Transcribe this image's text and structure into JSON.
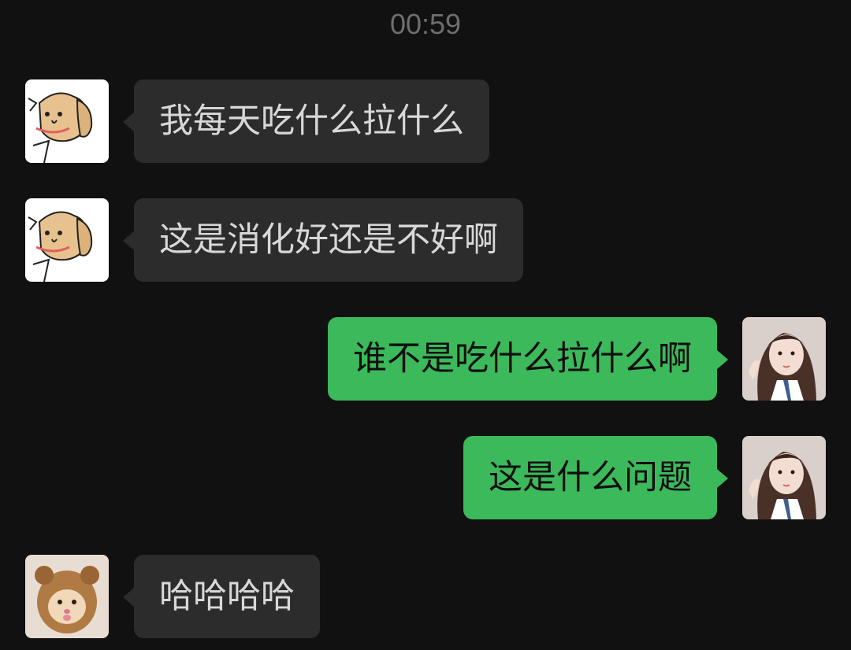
{
  "chat": {
    "timestamp": "00:59",
    "messages": [
      {
        "direction": "incoming",
        "sender_avatar": "dog-sticker-avatar",
        "text": "我每天吃什么拉什么"
      },
      {
        "direction": "incoming",
        "sender_avatar": "dog-sticker-avatar",
        "text": "这是消化好还是不好啊"
      },
      {
        "direction": "outgoing",
        "sender_avatar": "girl-photo-avatar",
        "text": "谁不是吃什么拉什么啊"
      },
      {
        "direction": "outgoing",
        "sender_avatar": "girl-photo-avatar",
        "text": "这是什么问题"
      },
      {
        "direction": "incoming",
        "sender_avatar": "cat-photo-avatar",
        "text": "哈哈哈哈"
      }
    ]
  },
  "colors": {
    "background": "#111111",
    "incoming_bubble": "#2c2c2c",
    "outgoing_bubble": "#3cb95a",
    "timestamp_text": "#6e6e6e"
  }
}
